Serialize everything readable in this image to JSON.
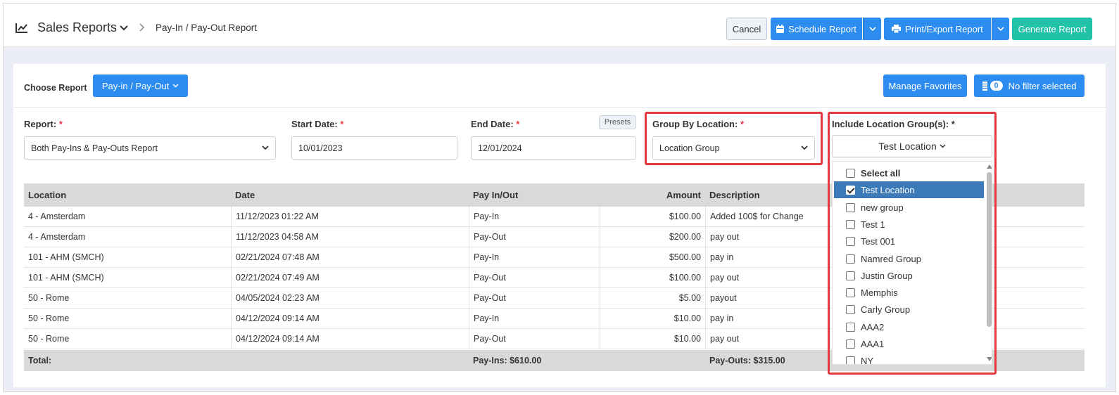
{
  "header": {
    "title": "Sales Reports",
    "breadcrumb": "Pay-In / Pay-Out Report",
    "buttons": {
      "cancel": "Cancel",
      "schedule": "Schedule Report",
      "print_export": "Print/Export Report",
      "generate": "Generate Report"
    }
  },
  "toolbar": {
    "choose_label": "Choose Report",
    "choose_value": "Pay-in / Pay-Out",
    "manage_favorites": "Manage Favorites",
    "filter_count": "0",
    "filter_label": "No filter selected"
  },
  "filters": {
    "report_label": "Report:",
    "report_value": "Both Pay-Ins & Pay-Outs Report",
    "start_label": "Start Date:",
    "start_value": "10/01/2023",
    "end_label": "End Date:",
    "end_value": "12/01/2024",
    "presets": "Presets",
    "group_label": "Group By Location:",
    "group_value": "Location Group",
    "include_label": "Include Location Group(s):",
    "include_value": "Test Location",
    "required_mark": "*"
  },
  "location_groups": [
    {
      "label": "Select all",
      "checked": false
    },
    {
      "label": "Test Location",
      "checked": true
    },
    {
      "label": "new group",
      "checked": false
    },
    {
      "label": "Test 1",
      "checked": false
    },
    {
      "label": "Test 001",
      "checked": false
    },
    {
      "label": "Namred Group",
      "checked": false
    },
    {
      "label": "Justin Group",
      "checked": false
    },
    {
      "label": "Memphis",
      "checked": false
    },
    {
      "label": "Carly Group",
      "checked": false
    },
    {
      "label": "AAA2",
      "checked": false
    },
    {
      "label": "AAA1",
      "checked": false
    },
    {
      "label": "NY",
      "checked": false
    }
  ],
  "table": {
    "columns": {
      "location": "Location",
      "date": "Date",
      "pay": "Pay In/Out",
      "amount": "Amount",
      "description": "Description"
    },
    "rows": [
      {
        "location": "4 - Amsterdam",
        "date": "11/12/2023 01:22 AM",
        "pay": "Pay-In",
        "amount": "$100.00",
        "description": "Added 100$ for Change"
      },
      {
        "location": "4 - Amsterdam",
        "date": "11/12/2023 04:58 AM",
        "pay": "Pay-Out",
        "amount": "$200.00",
        "description": "pay out"
      },
      {
        "location": "101 - AHM (SMCH)",
        "date": "02/21/2024 07:48 AM",
        "pay": "Pay-In",
        "amount": "$500.00",
        "description": "pay in"
      },
      {
        "location": "101 - AHM (SMCH)",
        "date": "02/21/2024 07:49 AM",
        "pay": "Pay-Out",
        "amount": "$100.00",
        "description": "pay out"
      },
      {
        "location": "50 - Rome",
        "date": "04/05/2024 02:23 AM",
        "pay": "Pay-Out",
        "amount": "$5.00",
        "description": "payout"
      },
      {
        "location": "50 - Rome",
        "date": "04/12/2024 09:14 AM",
        "pay": "Pay-In",
        "amount": "$10.00",
        "description": "pay in"
      },
      {
        "location": "50 - Rome",
        "date": "04/12/2024 09:14 AM",
        "pay": "Pay-Out",
        "amount": "$10.00",
        "description": "pay out"
      }
    ],
    "total": {
      "label": "Total:",
      "pay_ins": "Pay-Ins: $610.00",
      "pay_outs": "Pay-Outs: $315.00"
    }
  },
  "colors": {
    "primary": "#2d8cf0",
    "success": "#22c2a8",
    "highlight": "#e03a3e",
    "selected": "#3d7ab8"
  }
}
